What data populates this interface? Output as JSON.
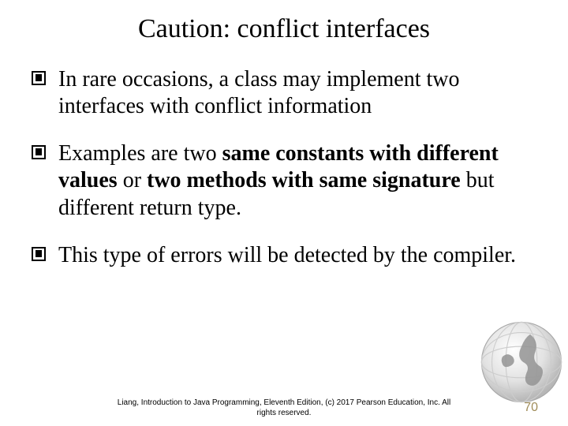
{
  "title": "Caution: conflict interfaces",
  "bullets": [
    {
      "pre": "In rare occasions, a class may implement two interfaces with conflict information",
      "bold": "",
      "post": ""
    },
    {
      "pre": "Examples are two ",
      "bold": "same constants with different values",
      "mid": " or ",
      "bold2": "two methods with same signature",
      "post": " but different return type."
    },
    {
      "pre": "This type of errors will be detected by the compiler.",
      "bold": "",
      "post": ""
    }
  ],
  "footer_line1": "Liang, Introduction to Java Programming, Eleventh Edition, (c) 2017 Pearson Education, Inc. All",
  "footer_line2": "rights reserved.",
  "page_number": "70"
}
